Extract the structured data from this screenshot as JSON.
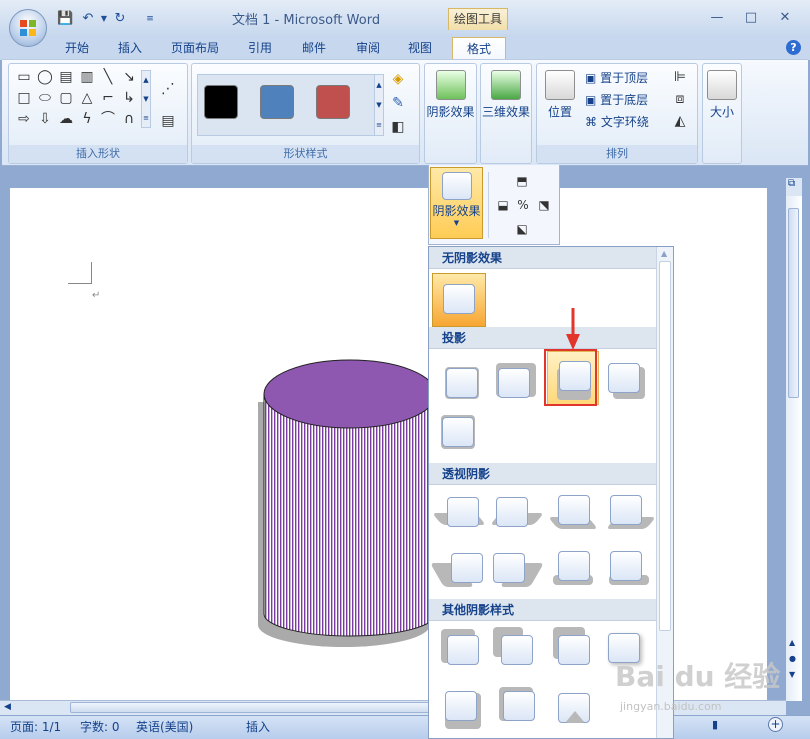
{
  "window": {
    "title": "文档 1 - Microsoft Word",
    "context_tab_group": "绘图工具"
  },
  "tabs": [
    {
      "label": "开始"
    },
    {
      "label": "插入"
    },
    {
      "label": "页面布局"
    },
    {
      "label": "引用"
    },
    {
      "label": "邮件"
    },
    {
      "label": "审阅"
    },
    {
      "label": "视图"
    },
    {
      "label": "格式"
    }
  ],
  "ribbon": {
    "insert_shapes": {
      "label": "插入形状"
    },
    "shape_styles": {
      "label": "形状样式",
      "swatches": [
        "#000000",
        "#4f81bd",
        "#c0504d"
      ]
    },
    "shadow_effects": {
      "label": "阴影效果"
    },
    "threed_effects": {
      "label": "三维效果"
    },
    "arrange": {
      "label": "排列",
      "position": "位置",
      "bring_to_front": "置于顶层",
      "send_to_back": "置于底层",
      "text_wrap": "文字环绕"
    },
    "size": {
      "label": "大小"
    }
  },
  "popup": {
    "shadow_button": "阴影效果"
  },
  "gallery": {
    "sections": {
      "no_shadow": "无阴影效果",
      "drop_shadow": "投影",
      "perspective_shadow": "透视阴影",
      "other_shadow": "其他阴影样式"
    }
  },
  "status": {
    "page": "页面: 1/1",
    "words": "字数: 0",
    "language": "英语(美国)",
    "mode": "插入"
  },
  "colors": {
    "cylinder_top": "#8e57b0",
    "cylinder_body": "#7a3d9e",
    "highlight_box": "#e2352b",
    "selected_tile": "#ffcc55"
  },
  "watermark": {
    "logo": "Bai du 经验",
    "url": "jingyan.baidu.com"
  }
}
